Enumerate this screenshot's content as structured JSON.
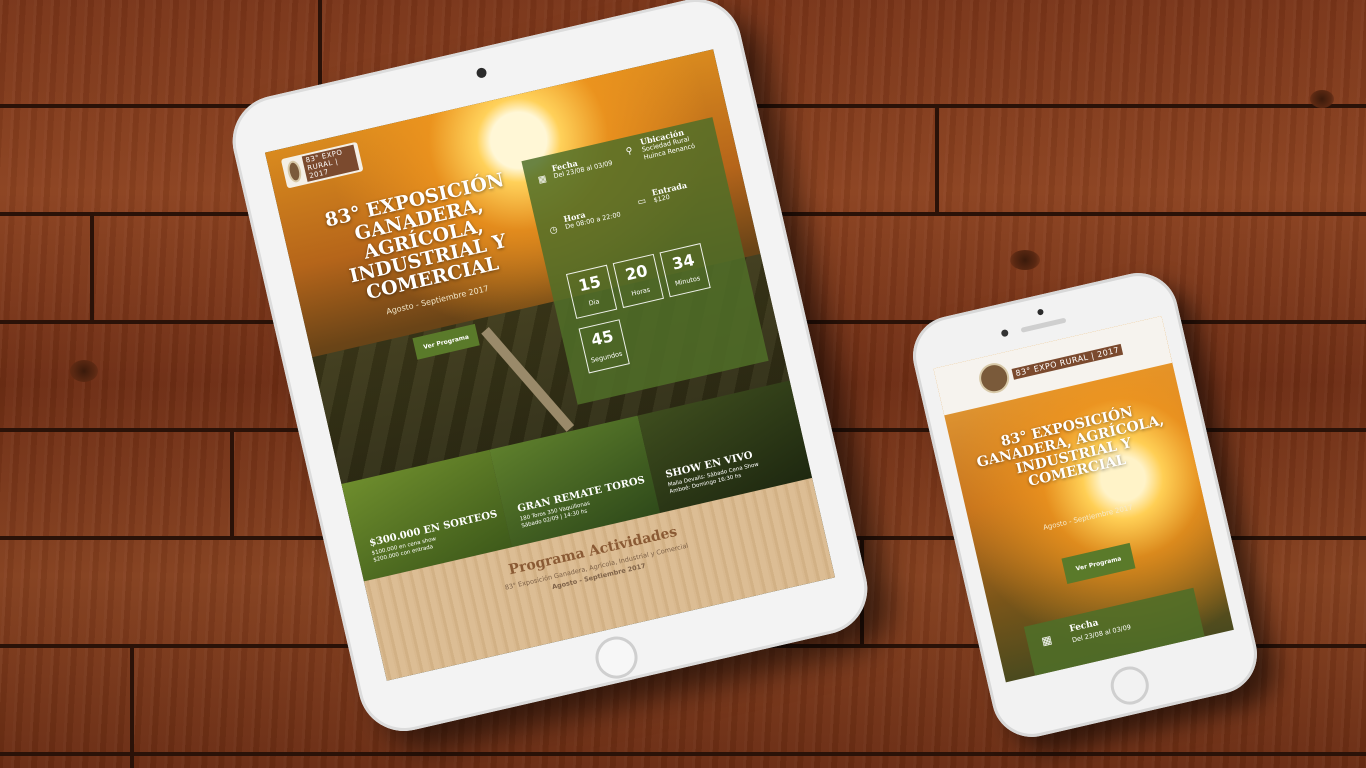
{
  "site": {
    "logo_text": "83° EXPO RURAL | 2017",
    "title": "83° Exposición Ganadera, Agrícola, Industrial y Comercial",
    "subtitle": "Agosto - Septiembre 2017",
    "cta": "Ver Programa"
  },
  "info": {
    "fecha_label": "Fecha",
    "fecha_value": "Del 23/08 al 03/09",
    "ubicacion_label": "Ubicación",
    "ubicacion_value": "Sociedad Rural Huinca Renancó",
    "hora_label": "Hora",
    "hora_value": "De 08:00 a 22:00",
    "entrada_label": "Entrada",
    "entrada_value": "$120"
  },
  "countdown": [
    {
      "num": "15",
      "unit": "Dia"
    },
    {
      "num": "20",
      "unit": "Horas"
    },
    {
      "num": "34",
      "unit": "Minutos"
    },
    {
      "num": "45",
      "unit": "Segundos"
    }
  ],
  "tiles": [
    {
      "title": "$300.000 en Sorteos",
      "line1": "$100.000 en cena show",
      "line2": "$200.000 con entrada"
    },
    {
      "title": "Gran Remate Toros",
      "line1": "180 Toros 350 Vaquillonas",
      "line2": "Sábado 02/09 | 14:30 hs"
    },
    {
      "title": "Show en Vivo",
      "line1": "Malia Devalis: Sábado Cena Show",
      "line2": "Amboé: Domingo 16:30 hs"
    }
  ],
  "programa": {
    "heading": "Programa Actividades",
    "line1": "83° Exposición Ganadera, Agrícola, Industrial y Comercial",
    "line2": "Agosto - Septiembre 2017"
  },
  "phone": {
    "fecha_label": "Fecha",
    "fecha_value": "Del 23/08 al 03/09"
  },
  "icons": {
    "calendar": "calendar-icon",
    "location": "location-pin-icon",
    "clock": "clock-icon",
    "ticket": "ticket-icon"
  },
  "colors": {
    "accent_green": "#5a7a2a",
    "heading_brown": "#8a5a34"
  }
}
